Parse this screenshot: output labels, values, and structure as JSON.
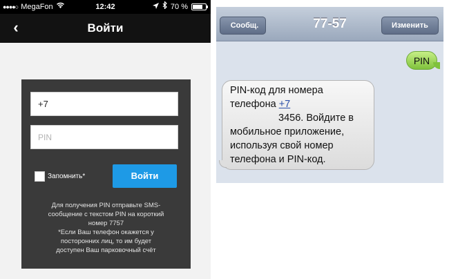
{
  "left_phone": {
    "statusbar": {
      "carrier": "MegaFon",
      "time": "12:42",
      "battery": "70 %"
    },
    "navbar": {
      "back_icon": "‹",
      "title": "Войти"
    },
    "form": {
      "phone_value": "+7",
      "pin_placeholder": "PIN",
      "remember_label": "Запомнить*",
      "login_button": "Войти",
      "info_lines": [
        "Для получения PIN отправьте SMS-",
        "сообщение с текстом PIN на короткий",
        "номер 7757",
        "*Если Ваш телефон окажется у",
        "посторонних лиц, то им будет",
        "доступен Ваш парковочный счёт"
      ]
    }
  },
  "right_phone": {
    "navbar": {
      "back_button": "Сообщ.",
      "title": "77-57",
      "edit_button": "Изменить"
    },
    "outgoing_message": "PIN",
    "incoming_message": {
      "line1": "PIN-код для номера",
      "line2_prefix": "телефона ",
      "phone_link": "+7",
      "line3": "3456. Войдите в",
      "line4": "мобильное приложение,",
      "line5": "используя свой номер",
      "line6": "телефона и PIN-код."
    },
    "colors": {
      "outgoing_bubble": "#7fc23c",
      "incoming_bubble": "#e6e6e6",
      "background": "#dbe2ec"
    }
  },
  "colors": {
    "login_button": "#1e9ae6",
    "panel": "#3a3a3a",
    "navbar": "#121212"
  }
}
